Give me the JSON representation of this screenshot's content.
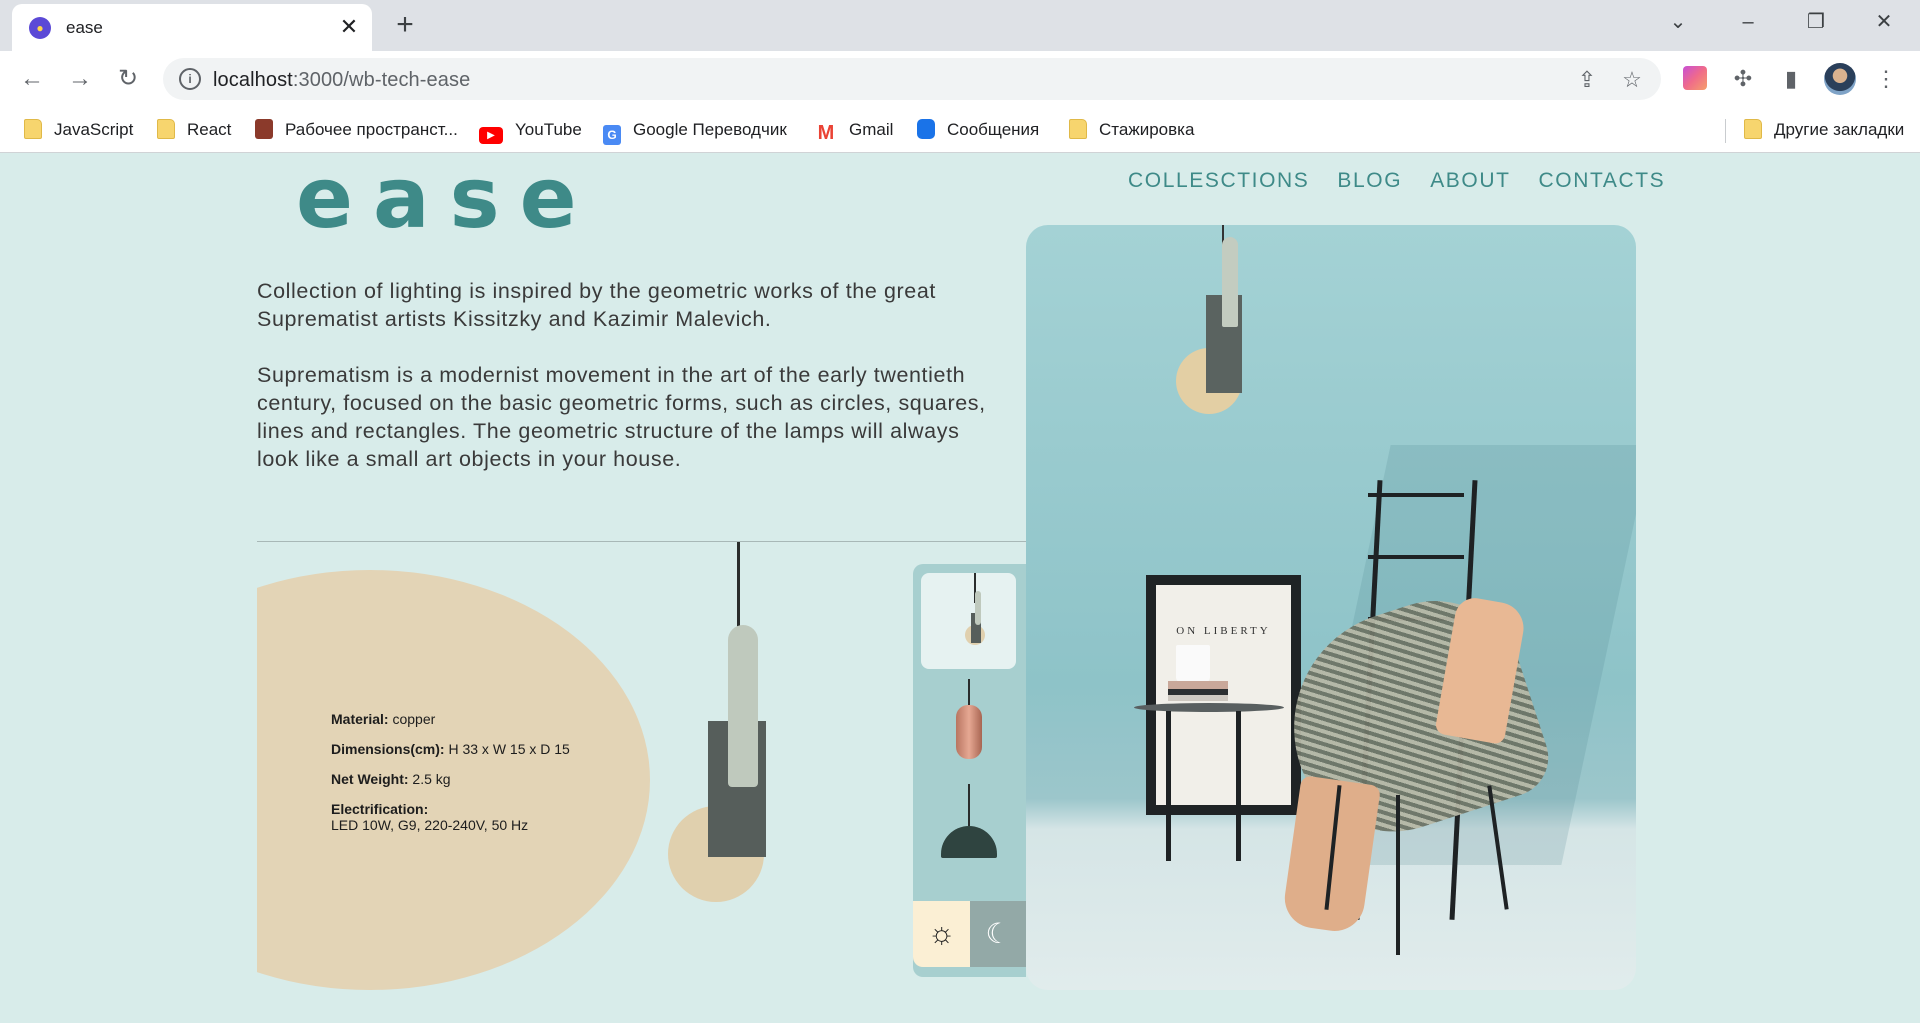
{
  "browser": {
    "tab_title": "ease",
    "url_host": "localhost",
    "url_path": ":3000/wb-tech-ease",
    "bookmarks": [
      {
        "label": "JavaScript",
        "icon": "folder-icon"
      },
      {
        "label": "React",
        "icon": "folder-icon"
      },
      {
        "label": "Рабочее пространст...",
        "icon": "briefcase-icon"
      },
      {
        "label": "YouTube",
        "icon": "youtube-icon"
      },
      {
        "label": "Google Переводчик",
        "icon": "google-translate-icon"
      },
      {
        "label": "Gmail",
        "icon": "gmail-icon"
      },
      {
        "label": "Сообщения",
        "icon": "messages-icon"
      },
      {
        "label": "Стажировка",
        "icon": "folder-icon"
      }
    ],
    "other_bookmarks": "Другие закладки"
  },
  "site": {
    "logo": "ease",
    "nav": [
      "COLLESCTIONS",
      "BLOG",
      "ABOUT",
      "CONTACTS"
    ],
    "intro": [
      "Collection of lighting is inspired by the geometric works of the great Suprematist artists Kissitzky and Kazimir Malevich.",
      "Suprematism is a modernist movement in the art of the early twentieth century, focused on the basic geometric forms, such as circles, squares, lines and rectangles. The geometric structure of the lamps will always look like a small art objects in your house."
    ],
    "specs": {
      "material_label": "Material:",
      "material_value": "copper",
      "dimensions_label": "Dimensions(cm):",
      "dimensions_value": "H 33 x W 15 x D 15",
      "weight_label": "Net Weight:",
      "weight_value": "2.5 kg",
      "electrification_label": "Electrification:",
      "electrification_value": "LED 10W, G9, 220-240V, 50 Hz"
    },
    "theme": {
      "light_icon": "sun-icon",
      "dark_icon": "moon-icon"
    },
    "photo_poster_text": "ON LIBERTY"
  },
  "colors": {
    "accent": "#3e8a88",
    "page_bg": "#d8ecea",
    "spec_circle": "#e3d4b6"
  }
}
